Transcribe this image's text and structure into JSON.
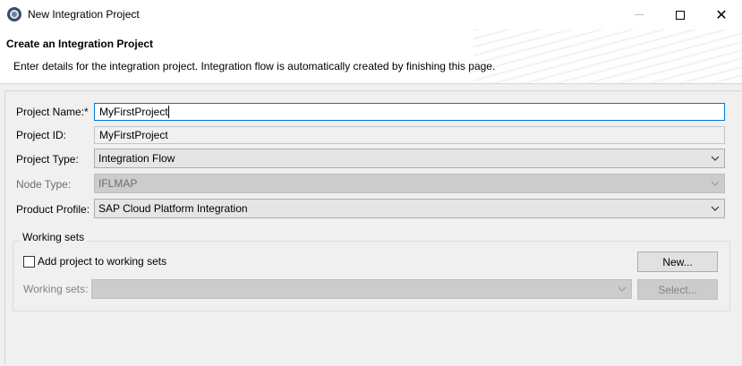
{
  "window": {
    "title": "New Integration Project",
    "icon": "eclipse-app-icon"
  },
  "banner": {
    "title": "Create an Integration Project",
    "description": "Enter details for the integration project. Integration flow is automatically created by finishing this page."
  },
  "form": {
    "project_name": {
      "label": "Project Name:*",
      "value": "MyFirstProject"
    },
    "project_id": {
      "label": "Project ID:",
      "value": "MyFirstProject"
    },
    "project_type": {
      "label": "Project Type:",
      "value": "Integration Flow"
    },
    "node_type": {
      "label": "Node Type:",
      "value": "IFLMAP"
    },
    "product_profile": {
      "label": "Product Profile:",
      "value": "SAP Cloud Platform Integration"
    }
  },
  "working_sets": {
    "group_title": "Working sets",
    "checkbox_label": "Add project to working sets",
    "checkbox_checked": false,
    "new_button": "New...",
    "label": "Working sets:",
    "value": "",
    "select_button": "Select..."
  },
  "colors": {
    "focus_border": "#0078d7",
    "disabled_background": "#cccccc",
    "dialog_background": "#f0f0f0"
  }
}
